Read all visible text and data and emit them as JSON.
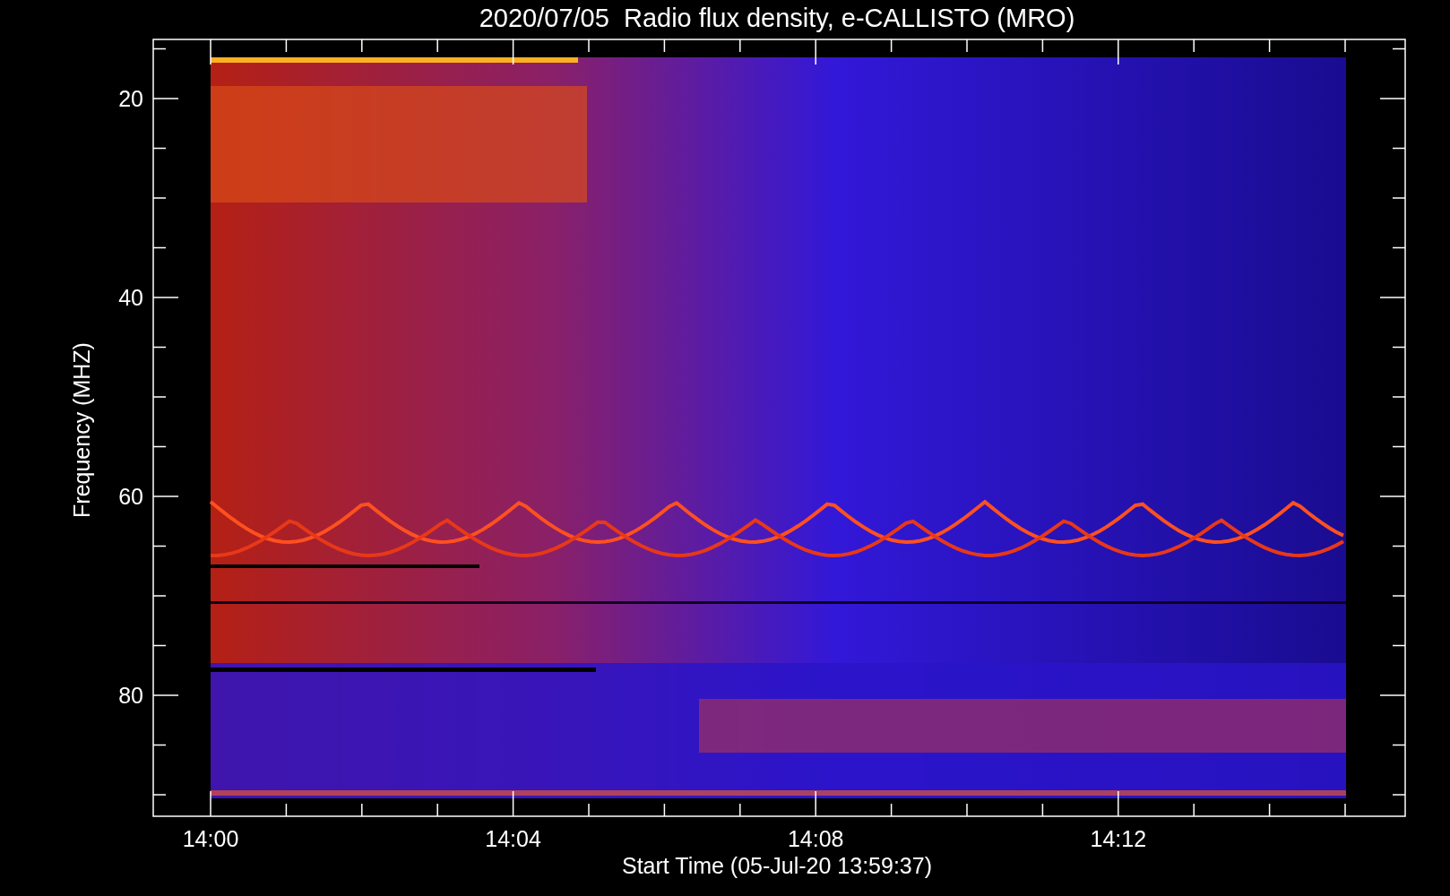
{
  "chart": {
    "title": "2020/07/05  Radio flux density, e-CALLISTO (MRO)",
    "ylabel": "Frequency (MHZ)",
    "xlabel": "Start Time (05-Jul-20 13:59:37)",
    "yticks": [
      "20",
      "40",
      "60",
      "80"
    ],
    "xticks": [
      "14:00",
      "14:04",
      "14:08",
      "14:12"
    ]
  }
}
